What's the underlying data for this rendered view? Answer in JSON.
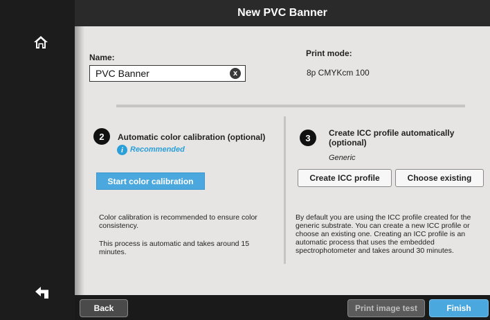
{
  "header": {
    "title": "New PVC Banner"
  },
  "form": {
    "name_label": "Name:",
    "name_value": "PVC Banner",
    "clear_glyph": "x",
    "print_mode_label": "Print mode:",
    "print_mode_value": "8p CMYKcm 100"
  },
  "calibration": {
    "step": "2",
    "title": "Automatic color calibration (optional)",
    "info_glyph": "i",
    "recommended": "Recommended",
    "button": "Start color calibration",
    "description_1": "Color calibration is recommended to ensure color consistency.",
    "description_2": "This process is automatic and takes around 15 minutes."
  },
  "icc": {
    "step": "3",
    "title": "Create ICC profile automatically (optional)",
    "subtitle": "Generic",
    "create_button": "Create ICC profile",
    "choose_button": "Choose existing",
    "description": "By default you are using the ICC profile created for the generic substrate. You can create a new ICC profile or choose an existing one. Creating an ICC profile is an automatic process that uses the embedded spectrophotometer and takes around 30 minutes."
  },
  "footer": {
    "back": "Back",
    "print_test": "Print image test",
    "finish": "Finish"
  },
  "icons": {
    "home": "home-icon",
    "back_nav": "undo-arrow-icon",
    "clear": "clear-x-icon",
    "info": "info-icon"
  },
  "colors": {
    "accent": "#4aa8df",
    "info": "#2a9fd8",
    "panel": "#e6e5e3",
    "chrome": "#1a1a1a"
  }
}
